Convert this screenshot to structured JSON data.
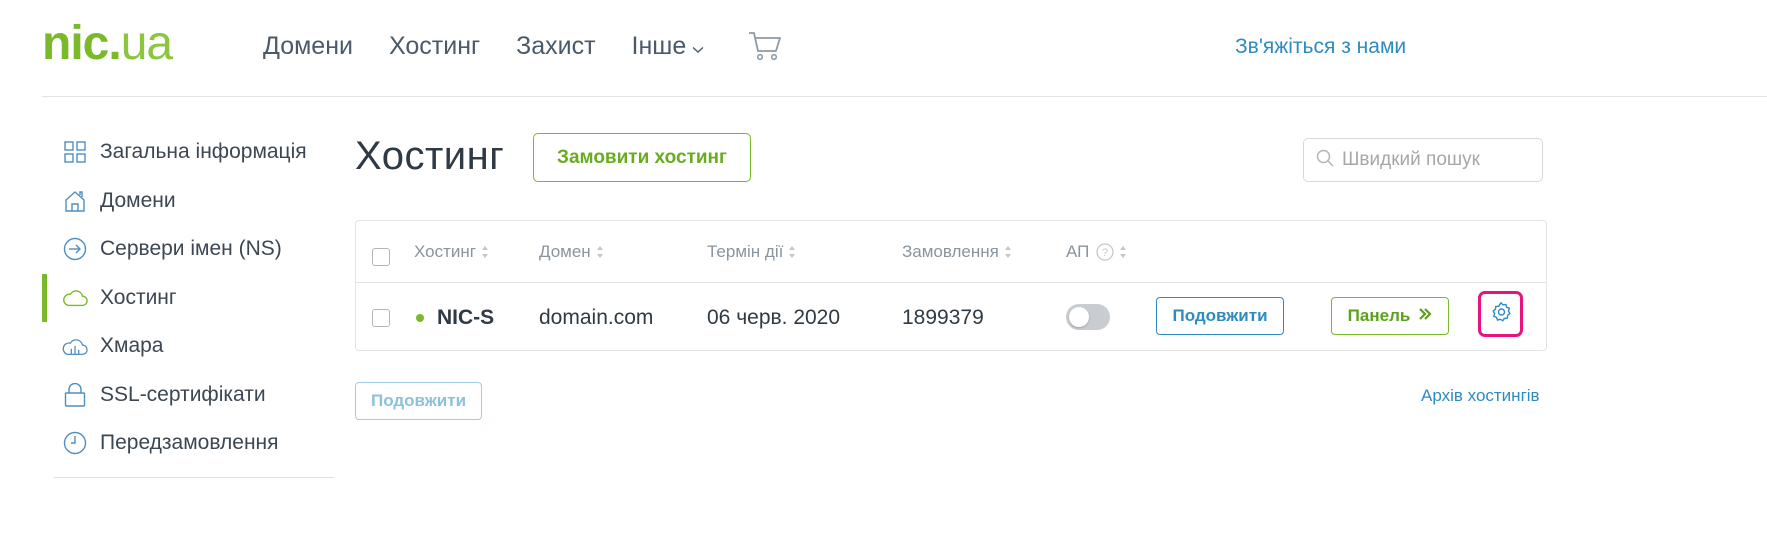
{
  "header": {
    "logo": {
      "main": "nic",
      "dot": ".",
      "tld": "ua"
    },
    "nav": [
      {
        "label": "Домени"
      },
      {
        "label": "Хостинг"
      },
      {
        "label": "Захист"
      },
      {
        "label": "Інше",
        "has_dropdown": true
      }
    ],
    "cart_icon": "cart-icon",
    "contact_label": "Зв'яжіться з нами"
  },
  "sidebar": {
    "items": [
      {
        "label": "Загальна інформація",
        "icon": "grid-icon",
        "active": false
      },
      {
        "label": "Домени",
        "icon": "house-icon",
        "active": false
      },
      {
        "label": "Сервери імен (NS)",
        "icon": "arrow-circle-icon",
        "active": false
      },
      {
        "label": "Хостинг",
        "icon": "cloud-icon",
        "active": true
      },
      {
        "label": "Хмара",
        "icon": "cloud-server-icon",
        "active": false
      },
      {
        "label": "SSL-сертифікати",
        "icon": "lock-icon",
        "active": false
      },
      {
        "label": "Передзамовлення",
        "icon": "clock-icon",
        "active": false
      }
    ]
  },
  "main": {
    "title": "Хостинг",
    "order_button": "Замовити хостинг",
    "search": {
      "placeholder": "Швидкий пошук",
      "value": ""
    },
    "table": {
      "columns": [
        {
          "label": "Хостинг",
          "sortable": true
        },
        {
          "label": "Домен",
          "sortable": true
        },
        {
          "label": "Термін дії",
          "sortable": true
        },
        {
          "label": "Замовлення",
          "sortable": true
        },
        {
          "label": "АП",
          "sortable": true,
          "help_icon": "help-circle-icon"
        }
      ],
      "rows": [
        {
          "status": "active",
          "hosting": "NIC-S",
          "domain": "domain.com",
          "expiry": "06 черв. 2020",
          "order": "1899379",
          "autorenew": false,
          "renew_label": "Подовжити",
          "panel_label": "Панель",
          "settings_icon": "gear-icon"
        }
      ]
    },
    "bulk_renew_label": "Подовжити",
    "archive_link": "Архів хостингів"
  },
  "colors": {
    "brand_green": "#7ab929",
    "link_blue": "#2e8bbf",
    "highlight": "#e6157d"
  }
}
